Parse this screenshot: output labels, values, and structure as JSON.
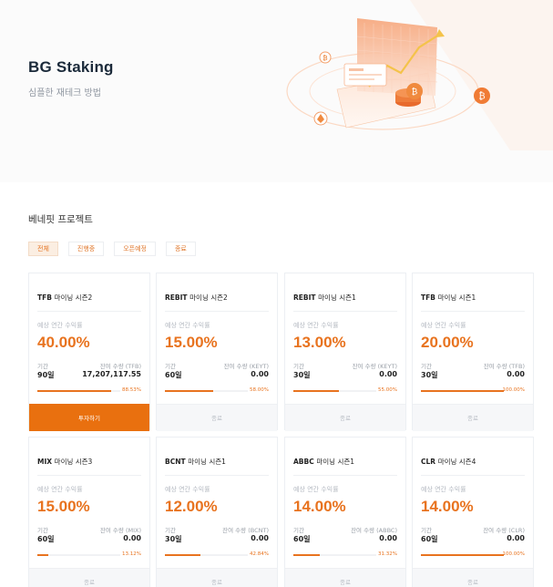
{
  "hero": {
    "title": "BG Staking",
    "subtitle": "심플한 재테크 방법"
  },
  "section": {
    "title": "베네핏 프로젝트"
  },
  "tabs": [
    {
      "label": "전체",
      "active": true
    },
    {
      "label": "진행중",
      "active": false
    },
    {
      "label": "오픈예정",
      "active": false
    },
    {
      "label": "종료",
      "active": false
    }
  ],
  "common": {
    "rate_label": "예상 연간 수익률",
    "period_label": "기간"
  },
  "cards": [
    {
      "token": "TFB",
      "season": "마이닝 시즌2",
      "rate": "40.00%",
      "period": "90일",
      "remain_label": "잔여 수량 (TFB)",
      "remain": "17,207,117.55",
      "progress": 0.8853,
      "progress_text": "88.53%",
      "button": "투자하기",
      "primary": true
    },
    {
      "token": "REBIT",
      "season": "마이닝 시즌2",
      "rate": "15.00%",
      "period": "60일",
      "remain_label": "잔여 수량 (KEYT)",
      "remain": "0.00",
      "progress": 0.58,
      "progress_text": "58.00%",
      "button": "종료",
      "primary": false
    },
    {
      "token": "REBIT",
      "season": "마이닝 시즌1",
      "rate": "13.00%",
      "period": "30일",
      "remain_label": "잔여 수량 (KEYT)",
      "remain": "0.00",
      "progress": 0.55,
      "progress_text": "55.00%",
      "button": "종료",
      "primary": false
    },
    {
      "token": "TFB",
      "season": "마이닝 시즌1",
      "rate": "20.00%",
      "period": "30일",
      "remain_label": "잔여 수량 (TFB)",
      "remain": "0.00",
      "progress": 1.0,
      "progress_text": "100.00%",
      "button": "종료",
      "primary": false
    },
    {
      "token": "MIX",
      "season": "마이닝 시즌3",
      "rate": "15.00%",
      "period": "60일",
      "remain_label": "잔여 수량 (MIX)",
      "remain": "0.00",
      "progress": 0.1312,
      "progress_text": "13.12%",
      "button": "종료",
      "primary": false
    },
    {
      "token": "BCNT",
      "season": "마이닝 시즌1",
      "rate": "12.00%",
      "period": "30일",
      "remain_label": "잔여 수량 (BCNT)",
      "remain": "0.00",
      "progress": 0.4284,
      "progress_text": "42.84%",
      "button": "종료",
      "primary": false
    },
    {
      "token": "ABBC",
      "season": "마이닝 시즌1",
      "rate": "14.00%",
      "period": "60일",
      "remain_label": "잔여 수량 (ABBC)",
      "remain": "0.00",
      "progress": 0.3132,
      "progress_text": "31.32%",
      "button": "종료",
      "primary": false
    },
    {
      "token": "CLR",
      "season": "마이닝 시즌4",
      "rate": "14.00%",
      "period": "60일",
      "remain_label": "잔여 수량 (CLR)",
      "remain": "0.00",
      "progress": 1.0,
      "progress_text": "100.00%",
      "button": "종료",
      "primary": false
    }
  ],
  "colors": {
    "accent": "#e9700f"
  },
  "icons": {
    "hero_illustration": "staking-chart-illustration",
    "coin": "bitcoin-coin-icon"
  }
}
